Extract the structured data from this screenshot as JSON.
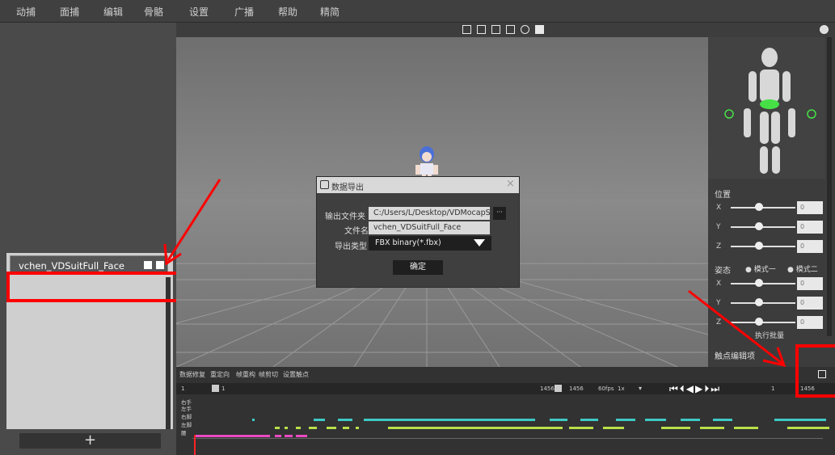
{
  "menu": [
    "动捕",
    "面捕",
    "编辑",
    "骨骼",
    "设置",
    "广播",
    "帮助",
    "精简"
  ],
  "file_list": {
    "item_name": "vchen_VDSuitFull_Face",
    "add_label": "+"
  },
  "dialog": {
    "title": "数据导出",
    "close_label": "×",
    "folder_label": "输出文件夹",
    "folder_value": "C:/Users/L/Desktop/VDMocapStudio",
    "browse_label": "···",
    "filename_label": "文件名",
    "filename_value": "vchen_VDSuitFull_Face",
    "type_label": "导出类型",
    "type_value": "FBX binary(*.fbx)",
    "confirm_label": "确定"
  },
  "right_panel": {
    "position_title": "位置",
    "pose_title": "姿态",
    "mode1": "模式一",
    "mode2": "模式二",
    "batch_label": "执行批量",
    "contact_title": "触点编辑项",
    "axes": [
      "X",
      "Y",
      "Z"
    ],
    "slider_value": "0"
  },
  "timeline": {
    "tabs": [
      "数据修复",
      "重定向",
      "帧重构",
      "帧剪切",
      "设置触点"
    ],
    "start_frame": "1",
    "current_frame": "1",
    "end_frame": "1456",
    "end_frame_field": "1456",
    "fps": "60fps",
    "speed": "1x",
    "frame_right": "1",
    "frame_right_end": "1456",
    "tracks": [
      "右手",
      "左手",
      "右脚",
      "左脚",
      "腰"
    ]
  },
  "colors": {
    "track_cyan": "#3ec9c4",
    "track_green": "#b8e04a",
    "track_pink": "#e94bc4",
    "highlight": "#ff0000",
    "body_highlight": "#46e046"
  }
}
